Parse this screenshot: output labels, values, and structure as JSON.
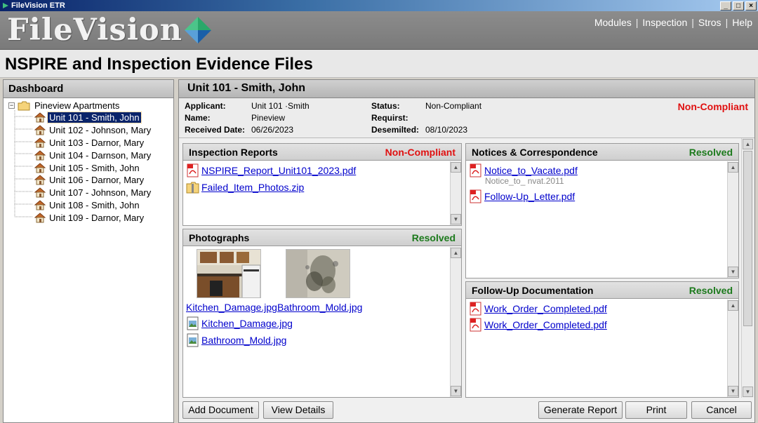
{
  "window": {
    "title": "FileVision ETR",
    "buttons": [
      "_",
      "□",
      "×"
    ]
  },
  "header": {
    "logo_text": "FileVision",
    "nav": [
      "Modules",
      "Inspection",
      "Stros",
      "Help"
    ]
  },
  "page_title": "NSPIRE and Inspection Evidence Files",
  "sidebar": {
    "title": "Dashboard",
    "root": "Pineview Apartments",
    "items": [
      "Unit 101 - Smith, John",
      "Unit 102 - Johnson, Mary",
      "Unit 103 - Darnor, Mary",
      "Unit 104 - Darnson, Mary",
      "Unit 105 - Smith, John",
      "Unit 106 - Darnor, Mary",
      "Unit 107 - Johnson, Mary",
      "Unit 108 - Smith, John",
      "Unit 109 - Darnor, Mary"
    ],
    "selected_index": 0
  },
  "main": {
    "title": "Unit 101 - Smith, John",
    "info": {
      "applicant_label": "Applicant:",
      "applicant": "Unit 101 ·Smith",
      "name_label": "Name:",
      "name": "Pineview",
      "received_label": "Received Date:",
      "received": "06/26/2023",
      "status_label": "Status:",
      "status": "Non-Compliant",
      "requirst_label": "Requirst:",
      "requirst": "",
      "desemilted_label": "Desemilted:",
      "desemilted": "08/10/2023",
      "status_badge": "Non-Compliant"
    },
    "panels": {
      "inspection": {
        "title": "Inspection Reports",
        "status": "Non-Compliant",
        "files": [
          "NSPIRE_Report_Unit101_2023.pdf",
          "Failed_Item_Photos.zip"
        ]
      },
      "photos": {
        "title": "Photographs",
        "status": "Resolved",
        "thumb_captions": [
          "Kitchen_Damage.jpg",
          "Bathroom_Mold.jpg"
        ],
        "files": [
          "Kitchen_Damage.jpg",
          "Bathroom_Mold.jpg"
        ]
      },
      "notices": {
        "title": "Notices & Correspondence",
        "status": "Resolved",
        "files": [
          "Notice_to_Vacate.pdf",
          "Follow-Up_Letter.pdf"
        ],
        "subnote": "Notice_to_ nvat.2011"
      },
      "followup": {
        "title": "Follow-Up Documentation",
        "status": "Resolved",
        "files": [
          "Work_Order_Completed.pdf",
          "Work_Order_Completed.pdf"
        ]
      }
    },
    "buttons": {
      "add": "Add Document",
      "view": "View Details",
      "report": "Generate Report",
      "print": "Print",
      "cancel": "Cancel"
    }
  },
  "colors": {
    "non_compliant": "#e01010",
    "resolved": "#1c7a1c",
    "link": "#0000cc",
    "selection": "#0a246a"
  }
}
